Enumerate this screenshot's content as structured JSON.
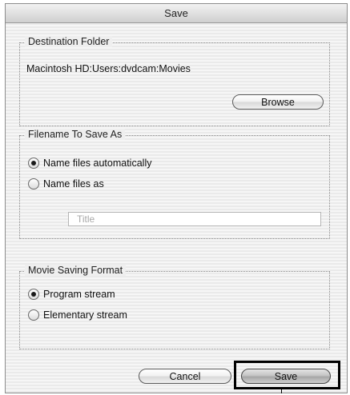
{
  "window": {
    "title": "Save"
  },
  "destination": {
    "group_title": "Destination Folder",
    "path": "Macintosh HD:Users:dvdcam:Movies",
    "browse_label": "Browse"
  },
  "filename": {
    "group_title": "Filename To Save As",
    "options": [
      {
        "label": "Name files automatically",
        "selected": true
      },
      {
        "label": "Name files as",
        "selected": false
      }
    ],
    "name_field": {
      "value": "",
      "placeholder": "Title"
    }
  },
  "format": {
    "group_title": "Movie Saving Format",
    "options": [
      {
        "label": "Program stream",
        "selected": true
      },
      {
        "label": "Elementary stream",
        "selected": false
      }
    ]
  },
  "buttons": {
    "cancel_label": "Cancel",
    "save_label": "Save"
  }
}
